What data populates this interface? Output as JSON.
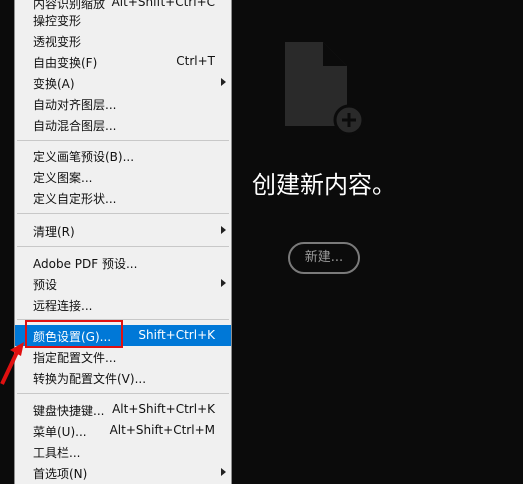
{
  "colors": {
    "workspace_bg": "#0b0b0b",
    "menu_bg": "#f0f0f0",
    "highlight": "#0078d7",
    "annotation_red": "#e01010"
  },
  "menu": {
    "items": [
      {
        "label": "内容识别缩放",
        "shortcut": "Alt+Shift+Ctrl+C",
        "submenu": false
      },
      {
        "label": "操控变形",
        "shortcut": "",
        "submenu": false
      },
      {
        "label": "透视变形",
        "shortcut": "",
        "submenu": false
      },
      {
        "label": "自由变换(F)",
        "shortcut": "Ctrl+T",
        "submenu": false
      },
      {
        "label": "变换(A)",
        "shortcut": "",
        "submenu": true
      },
      {
        "label": "自动对齐图层...",
        "shortcut": "",
        "submenu": false
      },
      {
        "label": "自动混合图层...",
        "shortcut": "",
        "submenu": false
      },
      {
        "label": "定义画笔预设(B)...",
        "shortcut": "",
        "submenu": false
      },
      {
        "label": "定义图案...",
        "shortcut": "",
        "submenu": false
      },
      {
        "label": "定义自定形状...",
        "shortcut": "",
        "submenu": false
      },
      {
        "label": "清理(R)",
        "shortcut": "",
        "submenu": true
      },
      {
        "label": "Adobe PDF 预设...",
        "shortcut": "",
        "submenu": false
      },
      {
        "label": "预设",
        "shortcut": "",
        "submenu": true
      },
      {
        "label": "远程连接...",
        "shortcut": "",
        "submenu": false
      },
      {
        "label": "颜色设置(G)...",
        "shortcut": "Shift+Ctrl+K",
        "submenu": false,
        "highlighted": true
      },
      {
        "label": "指定配置文件...",
        "shortcut": "",
        "submenu": false
      },
      {
        "label": "转换为配置文件(V)...",
        "shortcut": "",
        "submenu": false
      },
      {
        "label": "键盘快捷键...",
        "shortcut": "Alt+Shift+Ctrl+K",
        "submenu": false
      },
      {
        "label": "菜单(U)...",
        "shortcut": "Alt+Shift+Ctrl+M",
        "submenu": false
      },
      {
        "label": "工具栏...",
        "shortcut": "",
        "submenu": false
      },
      {
        "label": "首选项(N)",
        "shortcut": "",
        "submenu": true
      }
    ]
  },
  "start": {
    "headline": "创建新内容。",
    "new_button": "新建..."
  }
}
